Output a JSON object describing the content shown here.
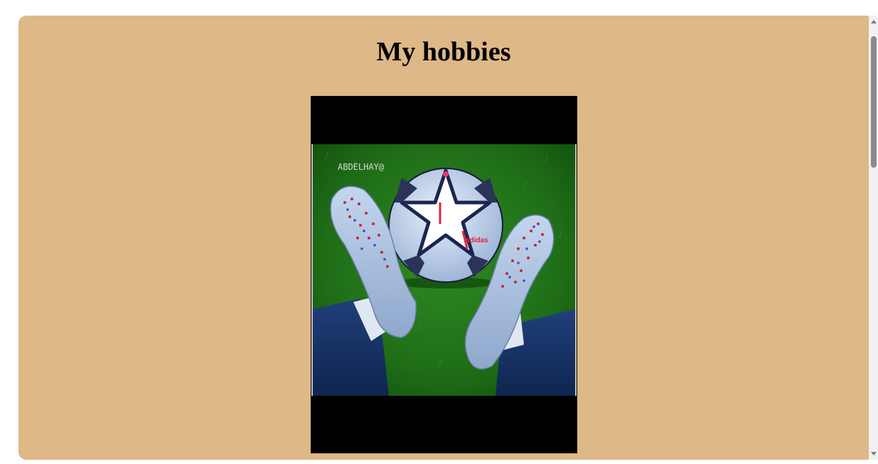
{
  "page": {
    "title": "My hobbies",
    "background_color": "#deb887"
  },
  "hobby_image": {
    "alt": "soccer ball between cleats on grass",
    "watermark": "ABDELHAY@",
    "ball_brand_text": "adidas"
  },
  "scrollbar": {
    "up_icon": "triangle-up",
    "down_icon": "triangle-down"
  }
}
